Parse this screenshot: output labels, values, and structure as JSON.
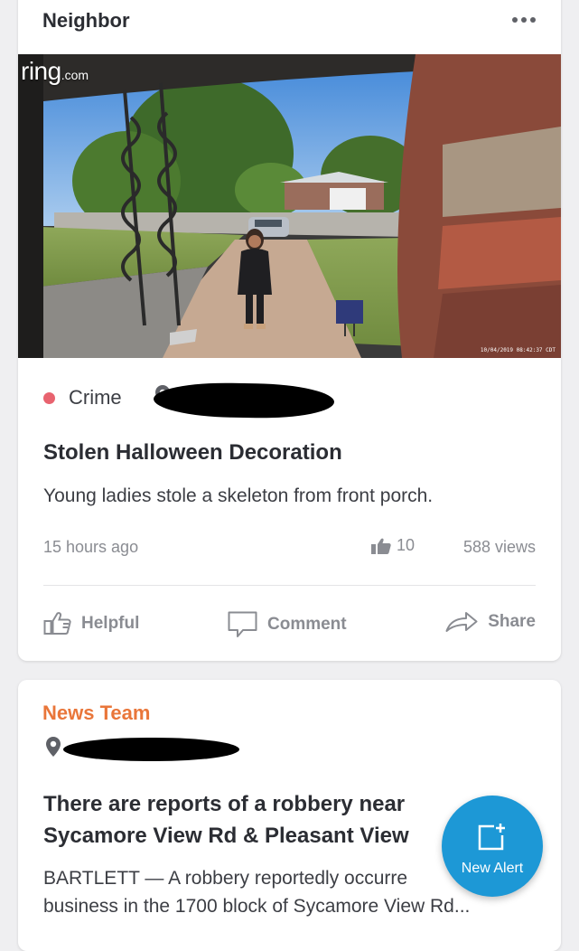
{
  "neighbor_card": {
    "header": "Neighbor",
    "video": {
      "logo_text": "ring",
      "logo_suffix": ".com",
      "timestamp": "10/04/2019 08:42:37 CDT"
    },
    "category": "Crime",
    "category_color": "#e8636f",
    "title": "Stolen Halloween Decoration",
    "description": "Young ladies stole a skeleton from front porch.",
    "time_ago": "15 hours ago",
    "likes": "10",
    "views": "588 views",
    "actions": {
      "helpful": "Helpful",
      "comment": "Comment",
      "share": "Share"
    }
  },
  "news_card": {
    "team": "News Team",
    "team_color": "#e9763a",
    "title_line1": "There are reports of a robbery near",
    "title_line2": "Sycamore View Rd & Pleasant View",
    "body_line1": "BARTLETT — A robbery reportedly occurre",
    "body_line2": "business in the 1700 block of Sycamore View Rd..."
  },
  "fab": {
    "label": "New Alert",
    "icon": "new-alert-icon",
    "color": "#1d98d6"
  }
}
